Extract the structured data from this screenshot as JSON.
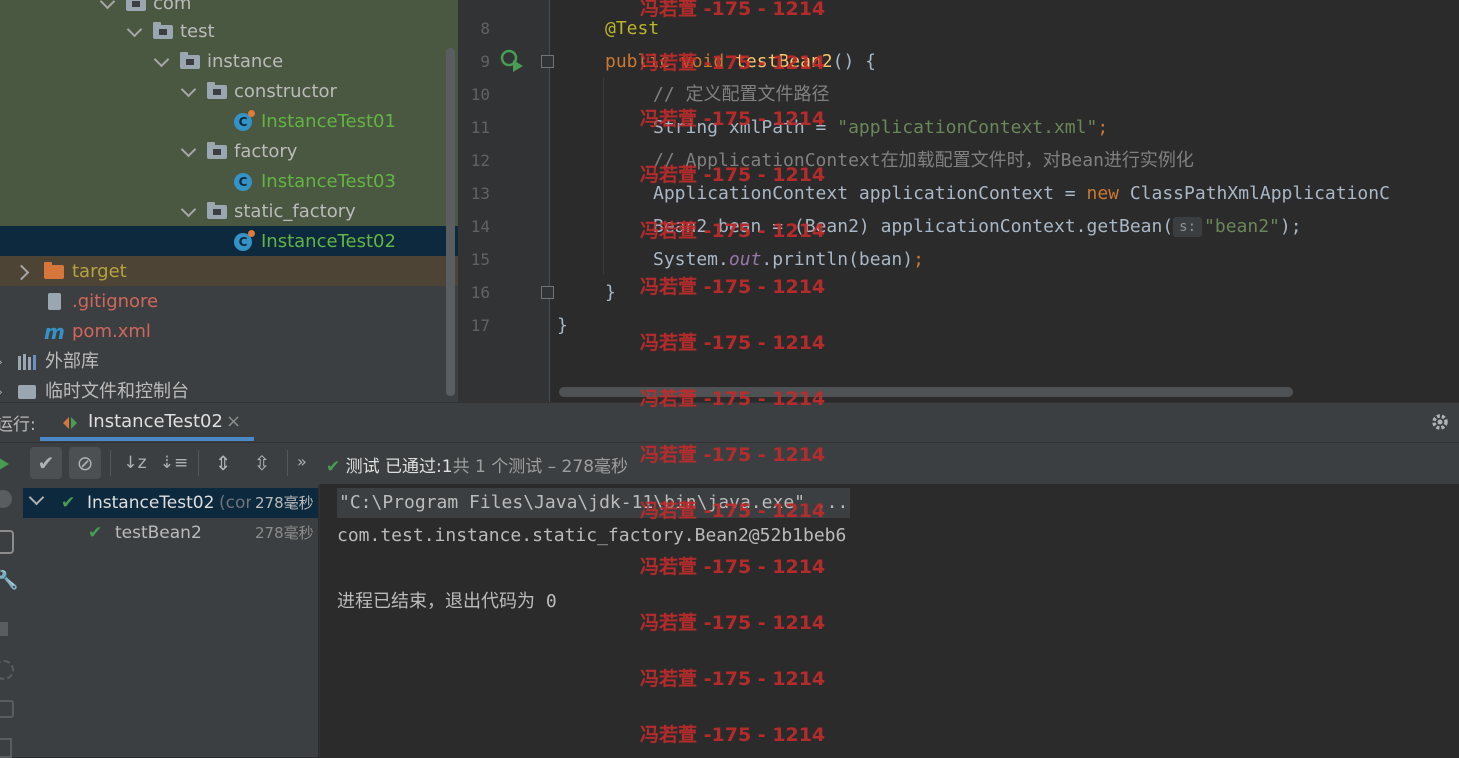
{
  "project_tree": {
    "items": [
      {
        "label": "com"
      },
      {
        "label": "test"
      },
      {
        "label": "instance"
      },
      {
        "label": "constructor"
      },
      {
        "label": "InstanceTest01"
      },
      {
        "label": "factory"
      },
      {
        "label": "InstanceTest03"
      },
      {
        "label": "static_factory"
      },
      {
        "label": "InstanceTest02"
      },
      {
        "label": "target"
      },
      {
        "label": ".gitignore"
      },
      {
        "label": "pom.xml"
      },
      {
        "label": "外部库"
      },
      {
        "label": "临时文件和控制台"
      }
    ]
  },
  "editor": {
    "line_numbers": [
      "8",
      "9",
      "10",
      "11",
      "12",
      "13",
      "14",
      "15",
      "16",
      "17"
    ],
    "code": {
      "l8_ann": "@Test",
      "l9_kw1": "public",
      "l9_kw2": "void",
      "l9_fn": "testBean2",
      "l9_rest": "() {",
      "l10_cmt": "// 定义配置文件路径",
      "l11_a": "String xmlPath = ",
      "l11_str": "\"applicationContext.xml\"",
      "l11_semi": ";",
      "l12_cmt": "// ApplicationContext在加载配置文件时，对Bean进行实例化",
      "l13_a": "ApplicationContext applicationContext = ",
      "l13_kw": "new",
      "l13_b": " ClassPathXmlApplicationC",
      "l14_a": "Bean2 bean = (Bean2) applicationContext.getBean(",
      "l14_hint": "s:",
      "l14_str": "\"bean2\"",
      "l14_end": ");",
      "l15_a": "System.",
      "l15_out": "out",
      "l15_b": ".println(bean)",
      "l15_semi": ";",
      "l16": "}",
      "l17": "}"
    }
  },
  "run_window": {
    "label": "运行:",
    "tab_label": "InstanceTest02",
    "status_passed": "测试 已通过:",
    "status_count": "1",
    "status_detail": "共 1 个测试 – 278毫秒",
    "tests": [
      {
        "name": "InstanceTest02",
        "suffix": "(cor",
        "time": "278毫秒"
      },
      {
        "name": "testBean2",
        "time": "278毫秒"
      }
    ],
    "console": [
      "\"C:\\Program Files\\Java\\jdk-11\\bin\\java.exe\" ...",
      "com.test.instance.static_factory.Bean2@52b1beb6",
      "",
      "进程已结束，退出代码为 0"
    ]
  },
  "watermark": "冯若萱 -175 - 1214",
  "colors": {
    "passed": "#499c54",
    "accent": "#4a88c7",
    "keyword": "#cc7832",
    "string": "#6a8759",
    "watermark": "#c42b2b"
  }
}
